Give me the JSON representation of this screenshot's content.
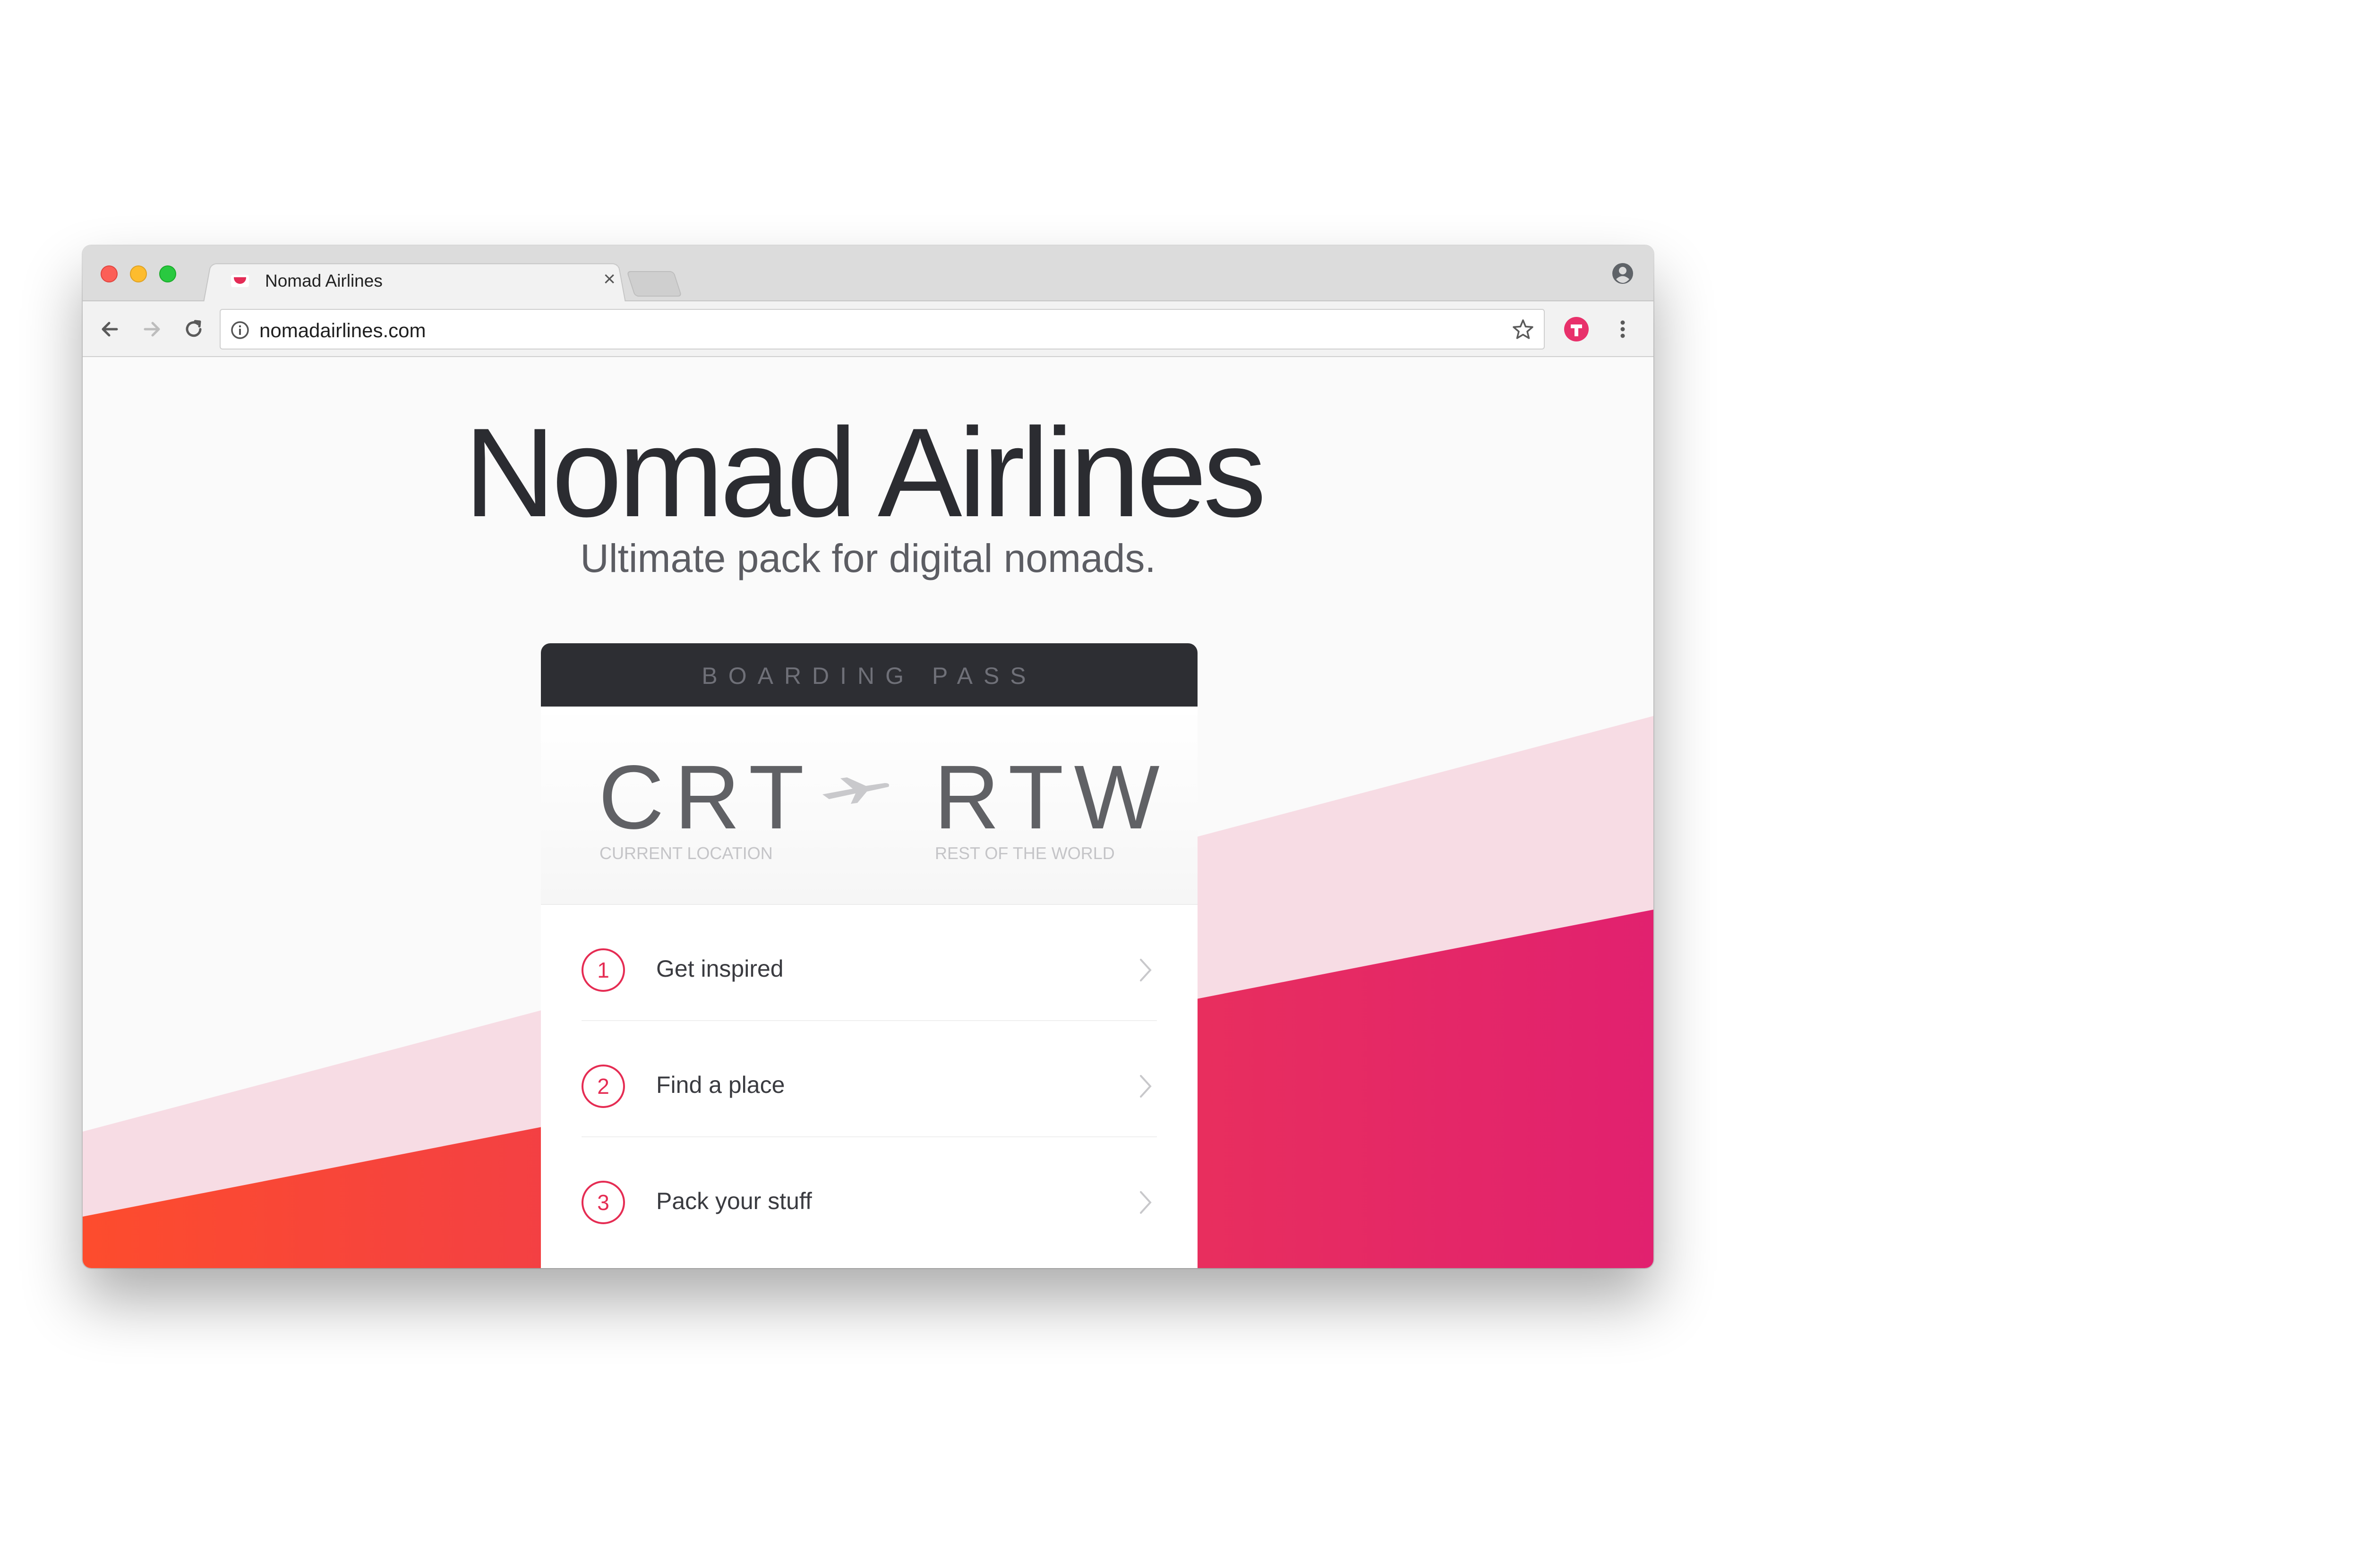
{
  "browser": {
    "tab_title": "Nomad Airlines",
    "tab_close": "×",
    "url": "nomadairlines.com",
    "icons": [
      "close-window-icon",
      "minimize-icon",
      "maximize-icon",
      "favicon",
      "profile-icon",
      "back-icon",
      "forward-icon",
      "reload-icon",
      "info-icon",
      "star-icon",
      "extension-icon",
      "menu-icon"
    ]
  },
  "page": {
    "title": "Nomad Airlines",
    "subtitle": "Ultimate pack for digital nomads."
  },
  "boarding_pass": {
    "header": "BOARDING PASS",
    "from_code": "CRT",
    "from_label": "CURRENT LOCATION",
    "to_code": "RTW",
    "to_label": "REST OF THE WORLD",
    "steps": [
      {
        "number": "1",
        "label": "Get inspired"
      },
      {
        "number": "2",
        "label": "Find a place"
      },
      {
        "number": "3",
        "label": "Pack your stuff"
      }
    ]
  },
  "colors": {
    "accent": "#e52c53",
    "gradient_start": "#fd4c2d",
    "gradient_end": "#e1216f",
    "dark": "#2d2e33"
  }
}
